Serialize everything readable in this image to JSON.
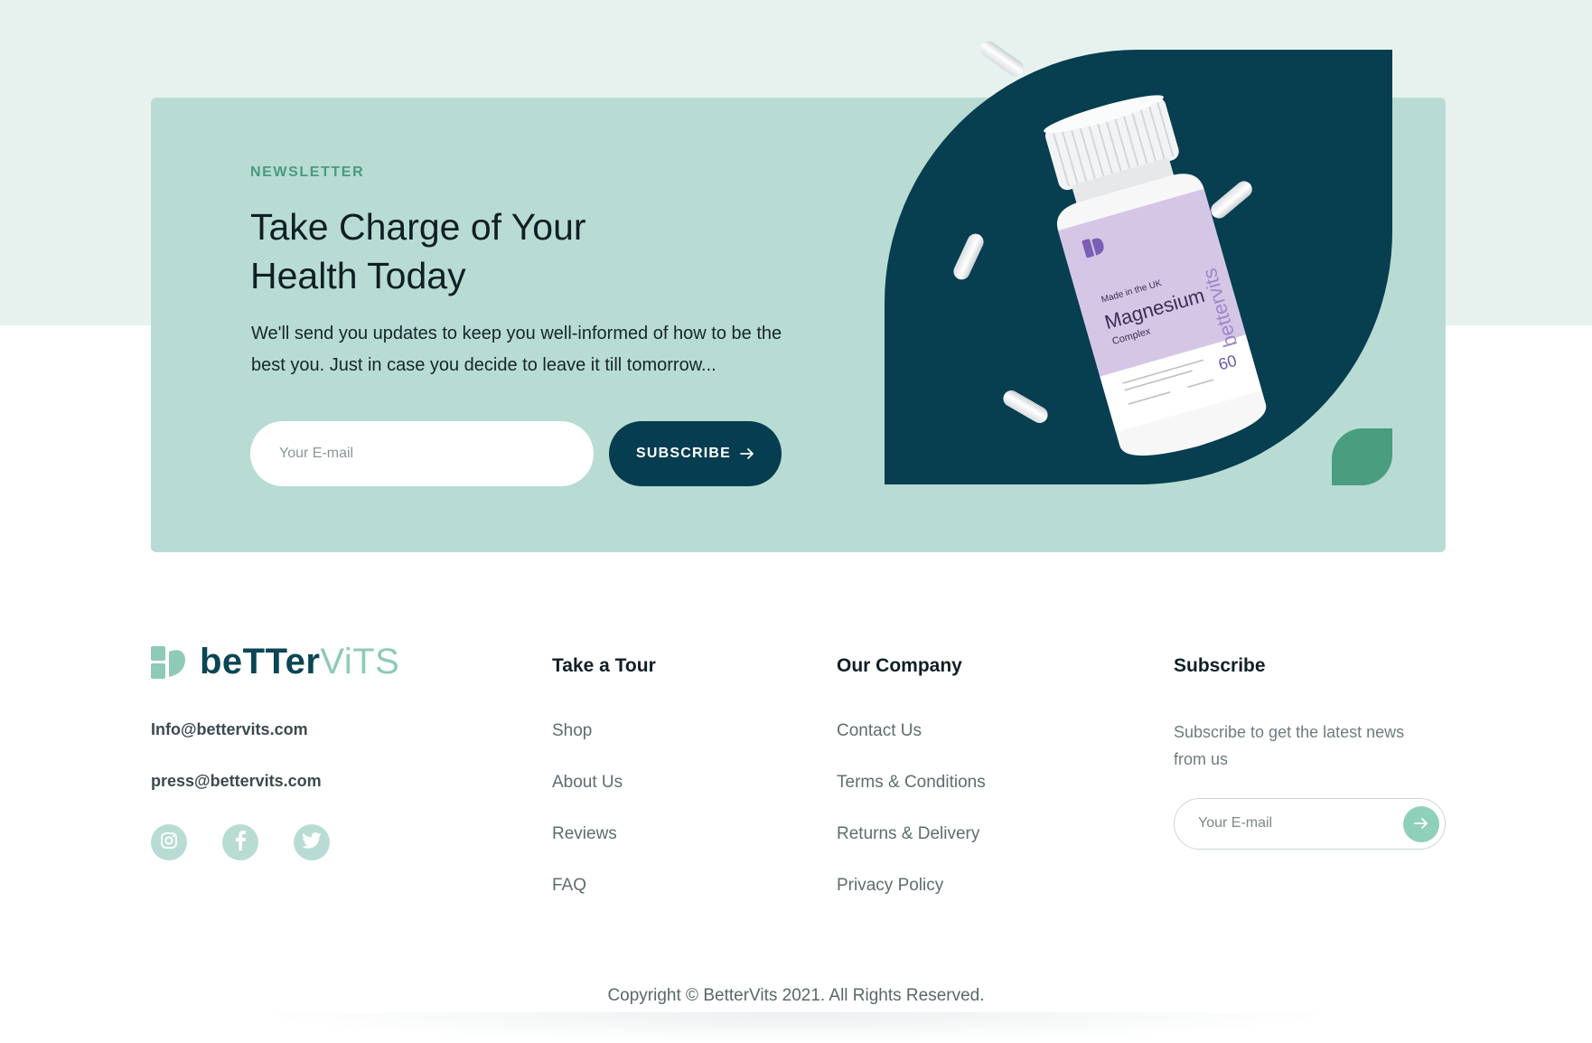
{
  "newsletter": {
    "eyebrow": "NEWSLETTER",
    "headline_line1": "Take Charge of Your",
    "headline_line2": "Health Today",
    "description": "We'll send you updates to keep you well-informed of how to be the best you. Just in case you decide to leave it till tomorrow...",
    "email_placeholder": "Your E-mail",
    "subscribe_label": "SUBSCRIBE",
    "product": {
      "origin": "Made in the UK",
      "name": "Magnesium",
      "variant": "Complex",
      "count": "60",
      "brand": "bettervits"
    }
  },
  "footer": {
    "logo": {
      "bold": "beTTer",
      "light": "ViTS"
    },
    "emails": [
      "Info@bettervits.com",
      "press@bettervits.com"
    ],
    "social": [
      {
        "icon": "instagram-icon"
      },
      {
        "icon": "facebook-icon"
      },
      {
        "icon": "twitter-icon"
      }
    ],
    "tour": {
      "title": "Take a Tour",
      "links": [
        "Shop",
        "About Us",
        "Reviews",
        "FAQ"
      ]
    },
    "company": {
      "title": "Our Company",
      "links": [
        "Contact Us",
        "Terms & Conditions",
        "Returns & Delivery",
        "Privacy Policy"
      ]
    },
    "subscribe": {
      "title": "Subscribe",
      "blurb": "Subscribe to get the latest news from us",
      "email_placeholder": "Your E-mail"
    },
    "copyright": "Copyright © BetterVits 2021. All Rights Reserved."
  },
  "colors": {
    "mint_band": "#e7f2ef",
    "card": "#b8dcd3",
    "navy": "#063d50",
    "green_accent": "#4a9d7f"
  }
}
